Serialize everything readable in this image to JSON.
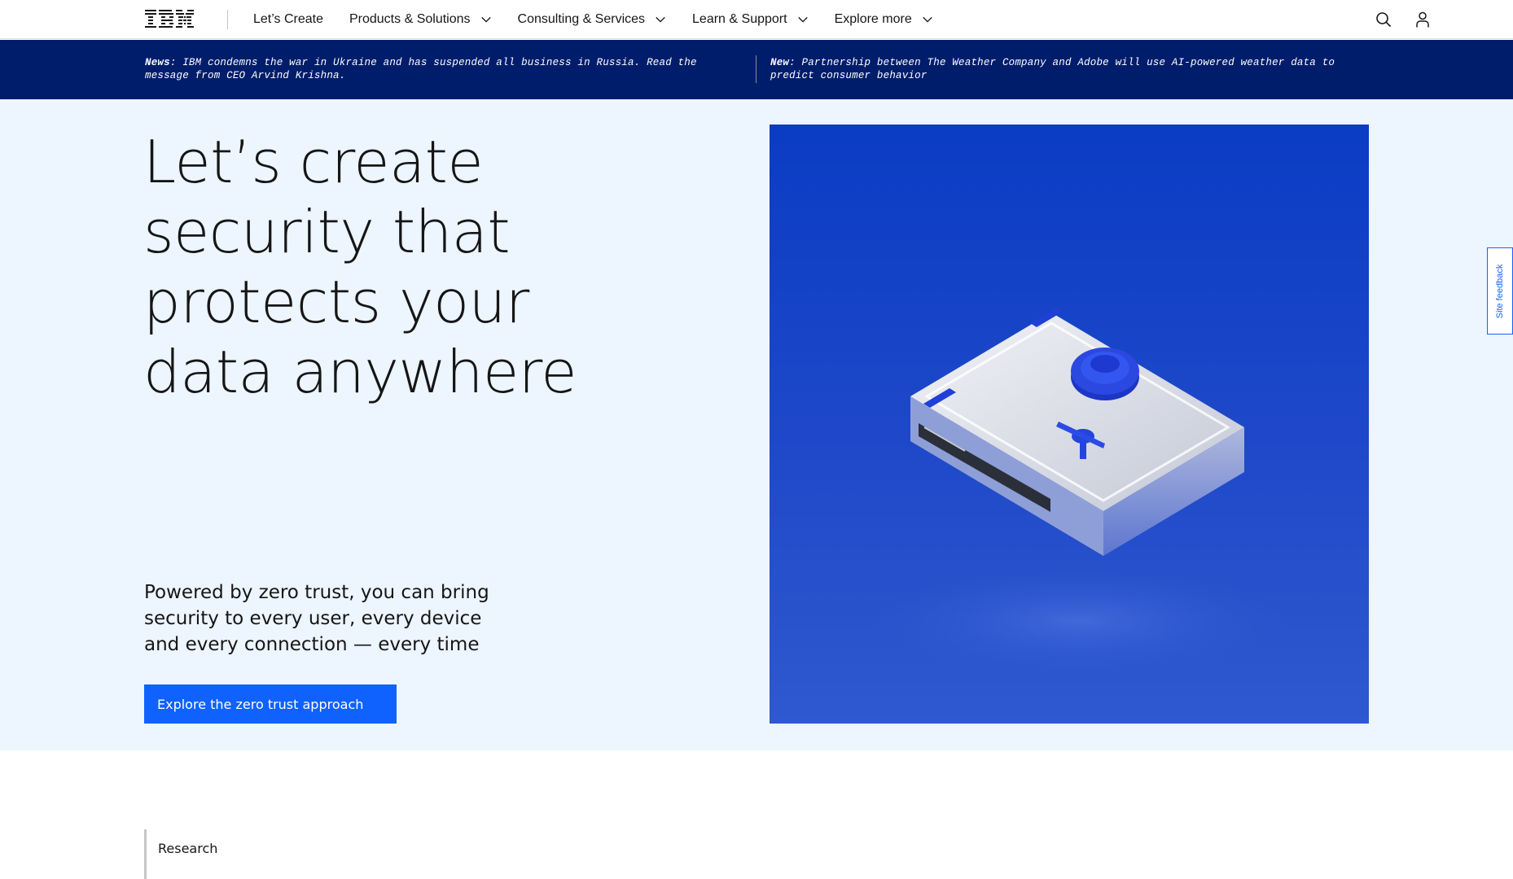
{
  "brand": {
    "logo_text": "IBM"
  },
  "nav": {
    "items": [
      {
        "label": "Let’s Create",
        "has_menu": false
      },
      {
        "label": "Products & Solutions",
        "has_menu": true
      },
      {
        "label": "Consulting & Services",
        "has_menu": true
      },
      {
        "label": "Learn & Support",
        "has_menu": true
      },
      {
        "label": "Explore more",
        "has_menu": true
      }
    ],
    "icons": [
      "search-icon",
      "user-icon"
    ]
  },
  "news": {
    "left": {
      "prefix": "News",
      "text": ": IBM condemns the war in Ukraine and has suspended all business in Russia. Read the message from CEO Arvind Krishna."
    },
    "right": {
      "prefix": "New",
      "text": ": Partnership between The Weather Company and Adobe will use AI-powered weather data to predict consumer behavior"
    }
  },
  "hero": {
    "title": "Let’s create security that protects your data anywhere",
    "subtitle": "Powered by zero trust, you can bring security to every user, every device and every connection — every time",
    "cta_label": "Explore the zero trust approach",
    "image_icon": "safe-illustration-icon"
  },
  "feedback": {
    "label": "Site feedback"
  },
  "section": {
    "label": "Research"
  },
  "colors": {
    "accent": "#0f62fe",
    "newsbar": "#001d6c",
    "hero_bg": "#edf5ff",
    "image_bg": "#1f46c7"
  }
}
